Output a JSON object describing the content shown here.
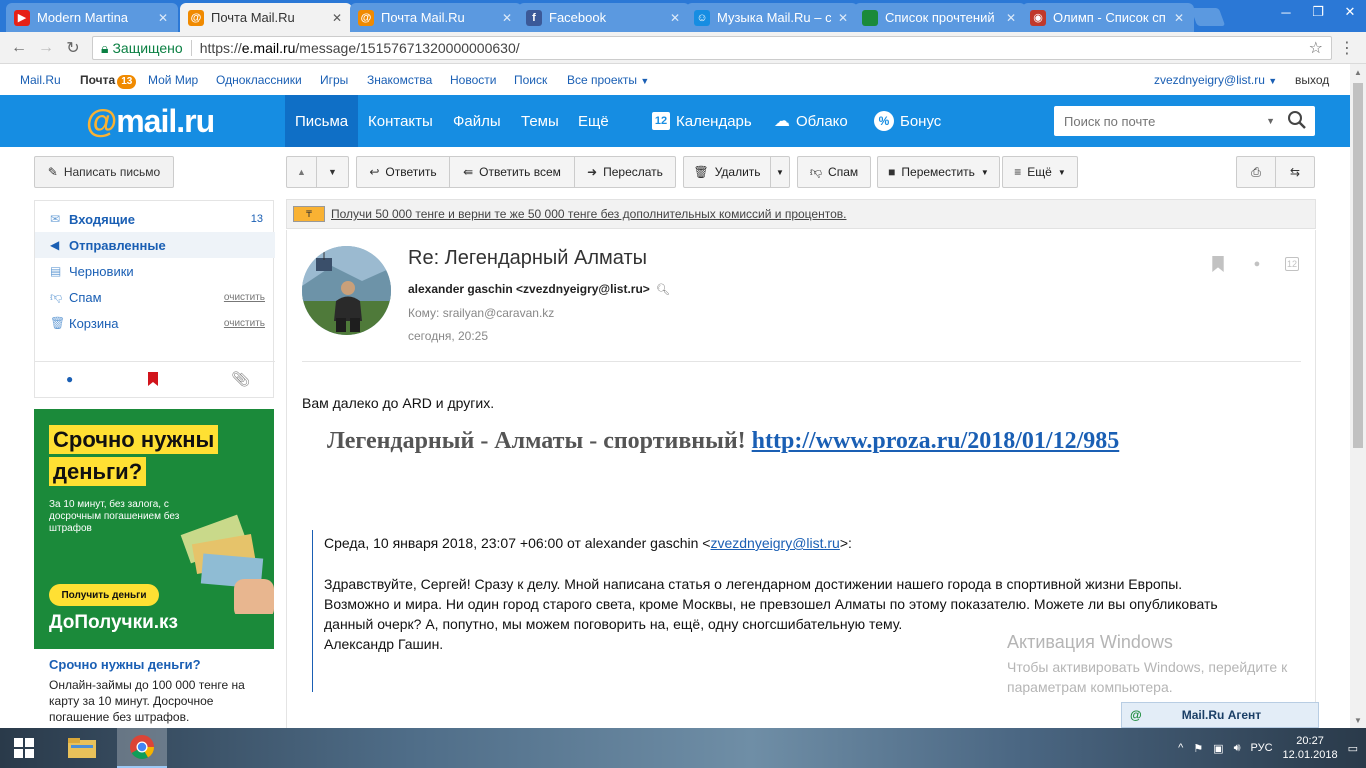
{
  "browser": {
    "tabs": [
      {
        "title": "Modern Martina",
        "icon": "youtube-icon",
        "color": "#e62117"
      },
      {
        "title": "Почта Mail.Ru",
        "icon": "mailru-icon",
        "color": "#f08a00"
      },
      {
        "title": "Почта Mail.Ru",
        "icon": "mailru-icon",
        "color": "#f08a00"
      },
      {
        "title": "Facebook",
        "icon": "facebook-icon",
        "color": "#3b5998"
      },
      {
        "title": "Музыка Mail.Ru – с",
        "icon": "music-icon",
        "color": "#168de2"
      },
      {
        "title": "Список прочтений",
        "icon": "sheet-icon",
        "color": "#1b8a3a"
      },
      {
        "title": "Олимп - Список сп",
        "icon": "olymp-icon",
        "color": "#c0392b"
      }
    ],
    "active_tab": 1,
    "secure_label": "Защищено",
    "url_prefix": "https://",
    "url_host": "e.mail.ru",
    "url_path": "/message/15157671320000000630/"
  },
  "portal": {
    "links": [
      "Mail.Ru",
      "Почта",
      "Мой Мир",
      "Одноклассники",
      "Игры",
      "Знакомства",
      "Новости",
      "Поиск",
      "Все проекты"
    ],
    "mail_count": "13",
    "user": "zvezdnyeigry@list.ru",
    "logout": "выход"
  },
  "header": {
    "logo_at": "@",
    "logo_text": "mail.ru",
    "nav": [
      "Письма",
      "Контакты",
      "Файлы",
      "Темы",
      "Ещё"
    ],
    "services": [
      "Календарь",
      "Облако",
      "Бонус"
    ],
    "calendar_day": "12",
    "search_placeholder": "Поиск по почте"
  },
  "sidebar": {
    "compose": "Написать письмо",
    "folders": [
      {
        "label": "Входящие",
        "count": "13",
        "clear": ""
      },
      {
        "label": "Отправленные",
        "count": "",
        "clear": ""
      },
      {
        "label": "Черновики",
        "count": "",
        "clear": ""
      },
      {
        "label": "Спам",
        "count": "",
        "clear": "очистить"
      },
      {
        "label": "Корзина",
        "count": "",
        "clear": "очистить"
      }
    ],
    "selected_folder": 1
  },
  "ad": {
    "line1": "Срочно нужны",
    "line2": "деньги?",
    "sub": "За 10 минут, без залога, с досрочным погашением без штрафов",
    "button": "Получить деньги",
    "brand": "ДоПолучки.кз",
    "title": "Срочно нужны деньги?",
    "text": "Онлайн-займы до 100 000 тенге на карту за 10 минут. Досрочное погашение без штрафов."
  },
  "toolbar": {
    "reply": "Ответить",
    "reply_all": "Ответить всем",
    "forward": "Переслать",
    "delete": "Удалить",
    "spam": "Спам",
    "move": "Переместить",
    "more": "Ещё"
  },
  "promo": {
    "text": "Получи 50 000 тенге и верни те же 50 000 тенге без дополнительных комиссий и процентов."
  },
  "message": {
    "subject": "Re: Легендарный Алматы",
    "from": "alexander gaschin <zvezdnyeigry@list.ru>",
    "to": "Кому: srailyan@caravan.kz",
    "date": "сегодня, 20:25",
    "body_line1": "Вам далеко до ARD и других.",
    "body_big": "Легендарный - Алматы - спортивный!",
    "body_link": "http://www.proza.ru/2018/01/12/985",
    "quote_head_pre": "Среда, 10 января 2018, 23:07 +06:00 от alexander gaschin <",
    "quote_head_link": "zvezdnyeigry@list.ru",
    "quote_head_post": ">:",
    "quote_line1": "Здравствуйте, Сергей! Сразу к делу. Мной написана статья о легендарном достижении нашего города в спортивной жизни Европы.",
    "quote_line2": "Возможно и мира. Ни один город старого света, кроме Москвы, не превзошел Алматы по этому показателю. Можете ли вы опубликовать",
    "quote_line3": "данный очерк? А, попутно, мы можем поговорить на, ещё, одну сногсшибательную тему.",
    "quote_line4": "Александр Гашин."
  },
  "overlay": {
    "activation_title": "Активация Windows",
    "activation_text": "Чтобы активировать Windows, перейдите к параметрам компьютера.",
    "agent": "Mail.Ru Агент"
  },
  "taskbar": {
    "lang": "РУС",
    "time": "20:27",
    "date": "12.01.2018"
  }
}
